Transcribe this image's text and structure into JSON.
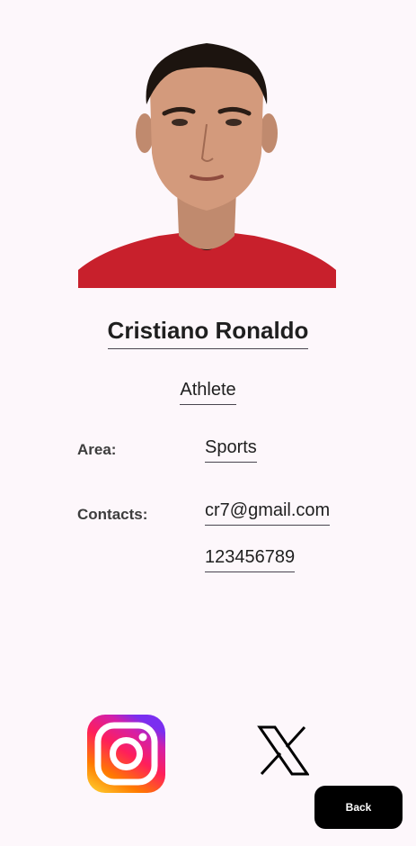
{
  "profile": {
    "name": "Cristiano Ronaldo",
    "role": "Athlete",
    "area_label": "Area:",
    "area_value": "Sports",
    "contacts_label": "Contacts:",
    "email": "cr7@gmail.com",
    "phone": "123456789"
  },
  "social": {
    "instagram_icon": "instagram-icon",
    "x_icon": "x-logo-icon"
  },
  "actions": {
    "back_label": "Back"
  },
  "colors": {
    "background": "#fdf7fb",
    "button_bg": "#000000",
    "jersey_red": "#c8202c"
  }
}
